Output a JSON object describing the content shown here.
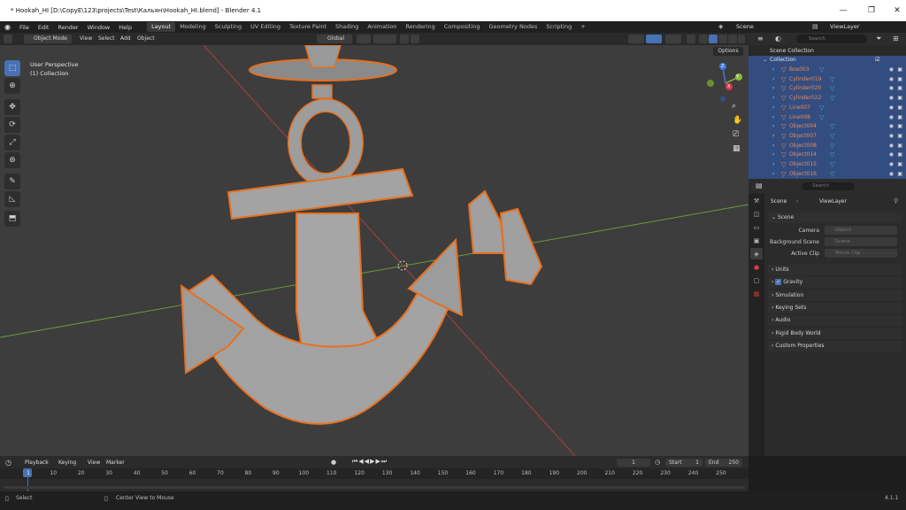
{
  "window": {
    "title": "* Hookah_HI [D:\\CopyE\\123\\projects\\Test\\Кальян\\Hookah_HI.blend] - Blender 4.1"
  },
  "menu": [
    "File",
    "Edit",
    "Render",
    "Window",
    "Help"
  ],
  "workspaces": [
    "Layout",
    "Modeling",
    "Sculpting",
    "UV Editing",
    "Texture Paint",
    "Shading",
    "Animation",
    "Rendering",
    "Compositing",
    "Geometry Nodes",
    "Scripting"
  ],
  "scene_field": "Scene",
  "viewlayer_field": "ViewLayer",
  "viewport_header": {
    "mode": "Object Mode",
    "menus": [
      "View",
      "Select",
      "Add",
      "Object"
    ],
    "orientation": "Global",
    "options": "Options"
  },
  "viewport": {
    "perspective": "User Perspective",
    "collection": "(1) Collection",
    "gizmo_x": "X",
    "gizmo_y": "Y",
    "gizmo_z": "Z"
  },
  "outliner": {
    "scene_collection": "Scene Collection",
    "collection": "Collection",
    "search_placeholder": "Search",
    "items": [
      "Box003",
      "Cylinder019",
      "Cylinder020",
      "Cylinder022",
      "Line007",
      "Line008",
      "Object004",
      "Object007",
      "Object008",
      "Object014",
      "Object015",
      "Object016"
    ]
  },
  "properties": {
    "search_placeholder": "Search",
    "breadcrumb_scene": "Scene",
    "breadcrumb_viewlayer": "ViewLayer",
    "section_scene": "Scene",
    "camera_label": "Camera",
    "camera_value": "Object",
    "bg_scene_label": "Background Scene",
    "bg_scene_value": "Scene",
    "active_clip_label": "Active Clip",
    "active_clip_value": "Movie Clip",
    "sections": [
      "Units",
      "Gravity",
      "Simulation",
      "Keying Sets",
      "Audio",
      "Rigid Body World",
      "Custom Properties"
    ],
    "gravity_checked": true
  },
  "timeline": {
    "menus": [
      "Playback",
      "Keying",
      "View",
      "Marker"
    ],
    "current_frame": "1",
    "start_label": "Start",
    "start": "1",
    "end_label": "End",
    "end": "250",
    "ruler": [
      "1",
      "10",
      "20",
      "30",
      "40",
      "50",
      "60",
      "70",
      "80",
      "90",
      "100",
      "110",
      "120",
      "130",
      "140",
      "150",
      "160",
      "170",
      "180",
      "190",
      "200",
      "210",
      "220",
      "230",
      "240",
      "250"
    ]
  },
  "status": {
    "select": "Select",
    "center": "Center View to Mouse",
    "version": "4.1.1"
  },
  "colors": {
    "accent": "#4772b3",
    "selection_orange": "#e8701e",
    "outliner_selected": "#334d80"
  }
}
